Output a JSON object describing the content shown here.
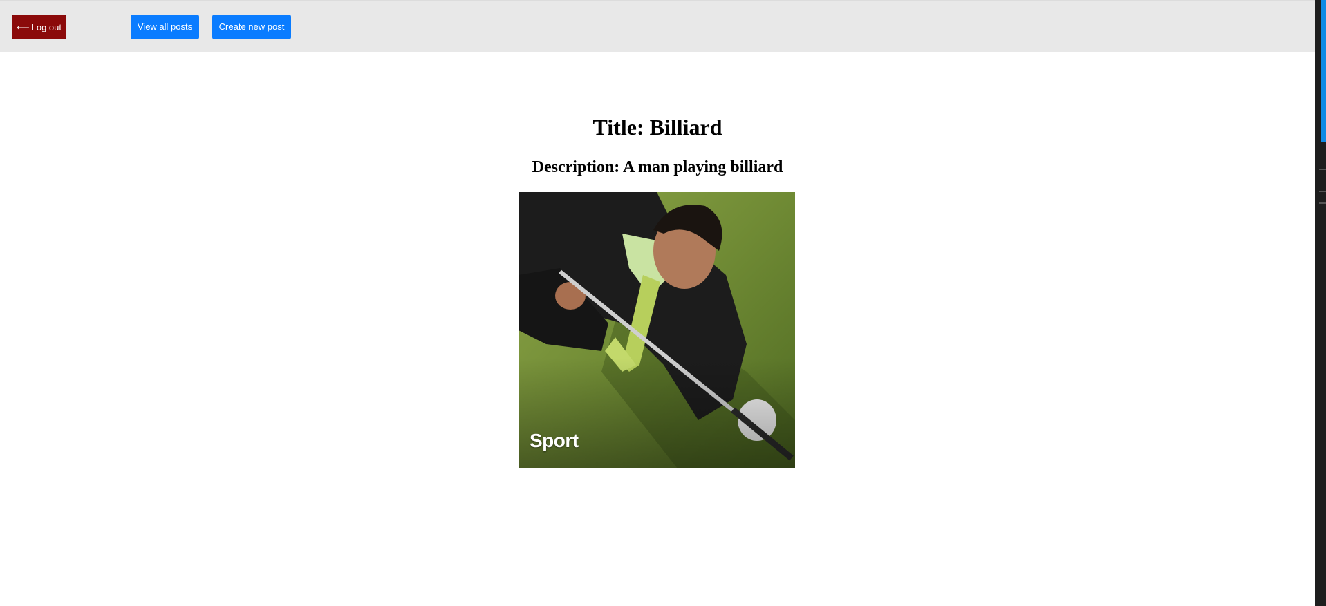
{
  "nav": {
    "logout_arrow": "⟵",
    "logout_label": "Log out",
    "view_all_label": "View all posts",
    "create_label": "Create new post"
  },
  "post": {
    "title": "Title: Billiard",
    "description": "Description: A man playing billiard",
    "image_caption": "Sport"
  },
  "colors": {
    "logout_button": "#8b0a0a",
    "primary_button": "#0a7cff",
    "topbar": "#e8e8e8",
    "image_grass": "#6f8a34"
  }
}
